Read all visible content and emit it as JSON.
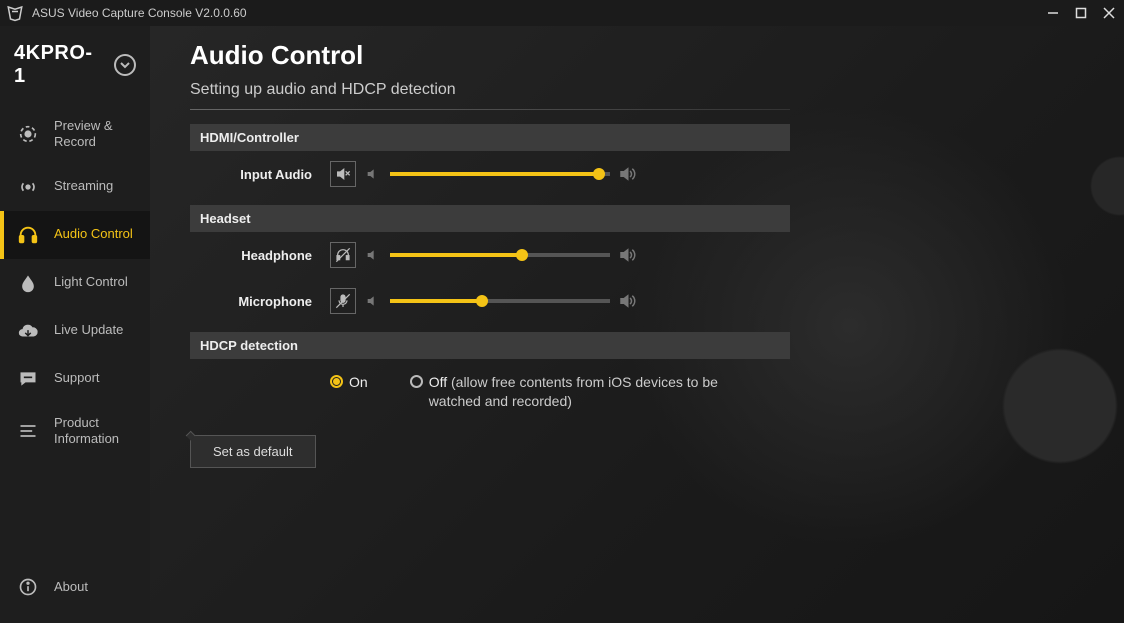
{
  "app": {
    "title": "ASUS Video Capture Console V2.0.0.60"
  },
  "device": {
    "name": "4KPRO-1"
  },
  "sidebar": {
    "items": [
      {
        "label": "Preview & Record"
      },
      {
        "label": "Streaming"
      },
      {
        "label": "Audio Control"
      },
      {
        "label": "Light Control"
      },
      {
        "label": "Live Update"
      },
      {
        "label": "Support"
      },
      {
        "label": "Product Information"
      }
    ],
    "about": "About"
  },
  "page": {
    "title": "Audio Control",
    "subtitle": "Setting up audio and HDCP detection"
  },
  "sections": {
    "hdmi": {
      "header": "HDMI/Controller",
      "input_audio_label": "Input Audio",
      "input_audio_value": 95
    },
    "headset": {
      "header": "Headset",
      "headphone_label": "Headphone",
      "headphone_value": 60,
      "microphone_label": "Microphone",
      "microphone_value": 42
    },
    "hdcp": {
      "header": "HDCP detection",
      "on_label": "On",
      "off_label": "Off",
      "off_hint": "(allow free contents from iOS devices to be watched and recorded)",
      "selected": "on"
    }
  },
  "buttons": {
    "set_default": "Set as default"
  }
}
